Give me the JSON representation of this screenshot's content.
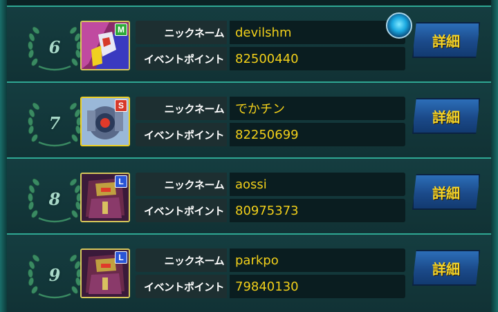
{
  "labels": {
    "nickname": "ニックネーム",
    "event_points": "イベントポイント",
    "detail_button": "詳細"
  },
  "entries": [
    {
      "rank": "6",
      "badge": "M",
      "nickname": "devilshm",
      "points": "82500440",
      "status_icon": "online-orb-icon"
    },
    {
      "rank": "7",
      "badge": "S",
      "nickname": "でかチン",
      "points": "82250699"
    },
    {
      "rank": "8",
      "badge": "L",
      "nickname": "aossi",
      "points": "80975373"
    },
    {
      "rank": "9",
      "badge": "L",
      "nickname": "parkpo",
      "points": "79840130"
    }
  ],
  "colors": {
    "value_text": "#f2d01a",
    "separator": "#2fa894",
    "button_blue": "#1b4a8a"
  }
}
